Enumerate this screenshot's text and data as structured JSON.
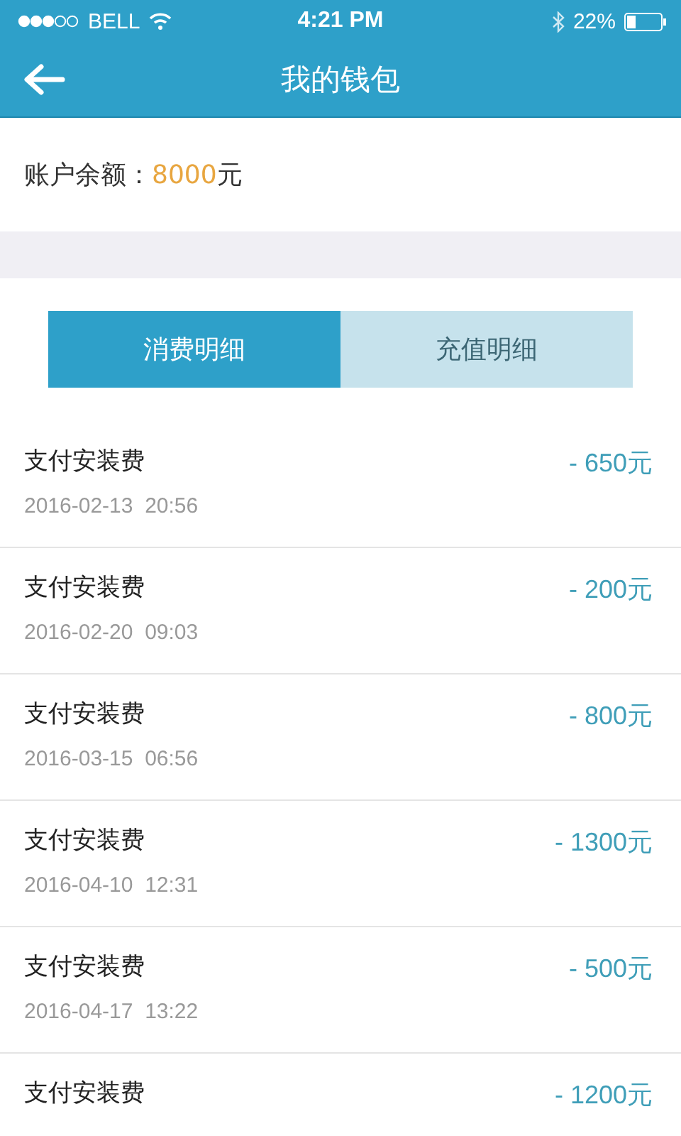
{
  "status_bar": {
    "carrier": "BELL",
    "time": "4:21 PM",
    "battery": "22%"
  },
  "nav": {
    "title": "我的钱包"
  },
  "balance": {
    "label": "账户余额：",
    "amount": "8000",
    "unit": "元"
  },
  "tabs": [
    {
      "label": "消费明细",
      "selected": true
    },
    {
      "label": "充值明细",
      "selected": false
    }
  ],
  "records": [
    {
      "title": "支付安装费",
      "date": "2016-02-13  20:56",
      "amount": "- 650元"
    },
    {
      "title": "支付安装费",
      "date": "2016-02-20  09:03",
      "amount": "- 200元"
    },
    {
      "title": "支付安装费",
      "date": "2016-03-15  06:56",
      "amount": "- 800元"
    },
    {
      "title": "支付安装费",
      "date": "2016-04-10  12:31",
      "amount": "- 1300元"
    },
    {
      "title": "支付安装费",
      "date": "2016-04-17  13:22",
      "amount": "- 500元"
    },
    {
      "title": "支付安装费",
      "amount": "- 1200元"
    }
  ]
}
